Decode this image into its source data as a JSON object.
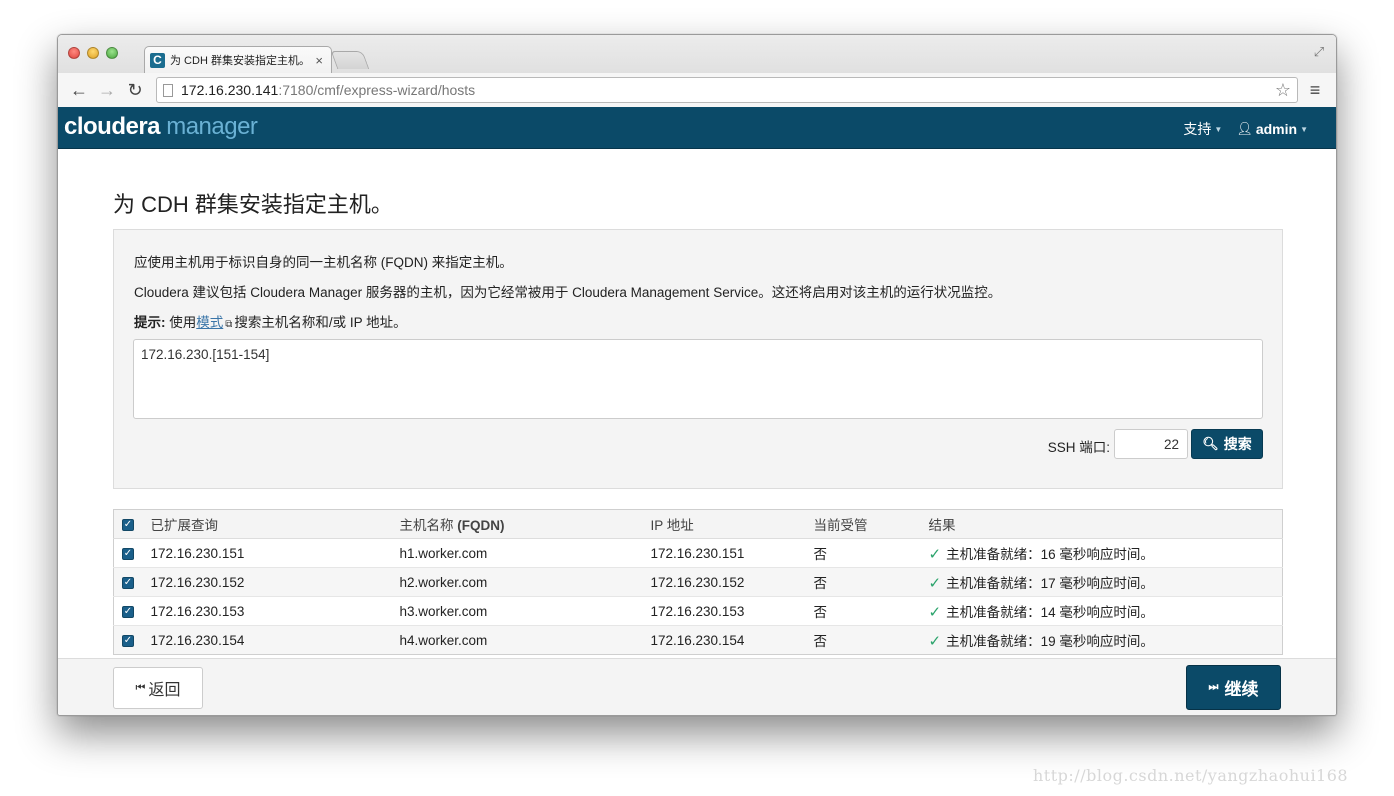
{
  "browser": {
    "tab_title": "为 CDH 群集安装指定主机。",
    "url_host": "172.16.230.141",
    "url_path": ":7180/cmf/express-wizard/hosts"
  },
  "navbar": {
    "brand_a": "cloudera",
    "brand_b": " manager",
    "support": "支持",
    "user": "admin"
  },
  "page": {
    "title": "为 CDH 群集安装指定主机。",
    "p1": "应使用主机用于标识自身的同一主机名称 (FQDN) 来指定主机。",
    "p2": "Cloudera 建议包括 Cloudera Manager 服务器的主机，因为它经常被用于 Cloudera Management Service。这还将启用对该主机的运行状况监控。",
    "hint_label": "提示:",
    "hint_pre": " 使用",
    "hint_link": "模式",
    "hint_post": "搜索主机名称和/或 IP 地址。",
    "hosts_value": "172.16.230.[151-154]",
    "ssh_label": "SSH 端口:",
    "ssh_value": "22",
    "search_label": "搜索"
  },
  "table": {
    "headers": {
      "query": "已扩展查询",
      "name_pre": "主机名称 ",
      "name_bold": "(FQDN)",
      "ip": "IP 地址",
      "managed": "当前受管",
      "result": "结果"
    },
    "rows": [
      {
        "query": "172.16.230.151",
        "name": "h1.worker.com",
        "ip": "172.16.230.151",
        "managed": "否",
        "result": "主机准备就绪：16 毫秒响应时间。"
      },
      {
        "query": "172.16.230.152",
        "name": "h2.worker.com",
        "ip": "172.16.230.152",
        "managed": "否",
        "result": "主机准备就绪：17 毫秒响应时间。"
      },
      {
        "query": "172.16.230.153",
        "name": "h3.worker.com",
        "ip": "172.16.230.153",
        "managed": "否",
        "result": "主机准备就绪：14 毫秒响应时间。"
      },
      {
        "query": "172.16.230.154",
        "name": "h4.worker.com",
        "ip": "172.16.230.154",
        "managed": "否",
        "result": "主机准备就绪：19 毫秒响应时间。"
      }
    ]
  },
  "footer": {
    "back": "返回",
    "continue": "继续"
  },
  "watermark": "http://blog.csdn.net/yangzhaohui168"
}
